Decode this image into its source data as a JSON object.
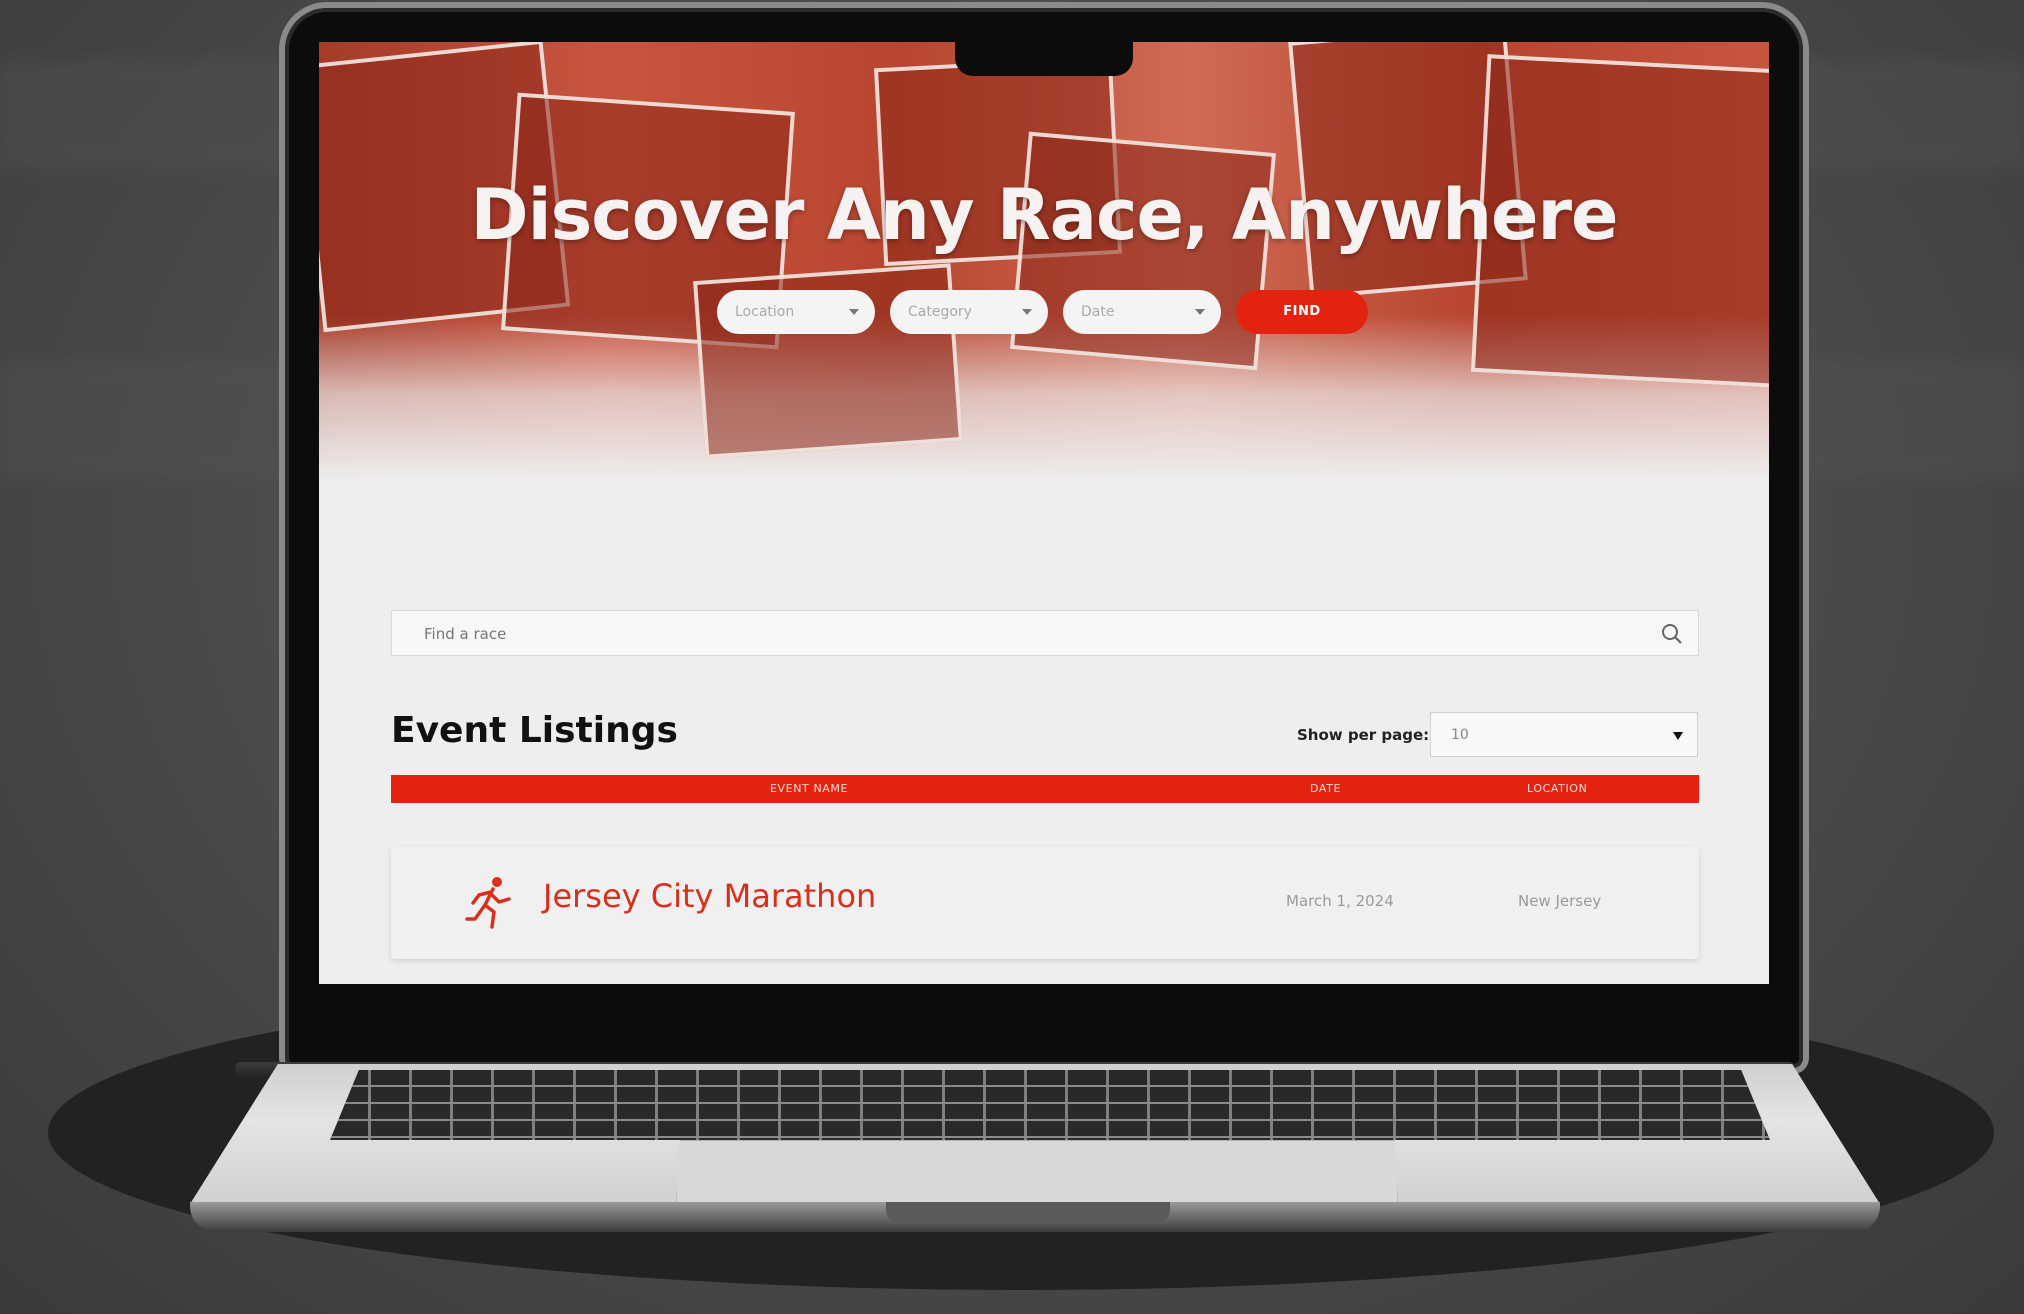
{
  "hero": {
    "title": "Discover Any Race, Anywhere",
    "filters": [
      {
        "placeholder": "Location"
      },
      {
        "placeholder": "Category"
      },
      {
        "placeholder": "Date"
      }
    ],
    "find_label": "FIND"
  },
  "search": {
    "placeholder": "Find a race"
  },
  "listings": {
    "title": "Event Listings",
    "per_page_label": "Show per page:",
    "per_page_value": "10",
    "columns": [
      "EVENT NAME",
      "DATE",
      "LOCATION"
    ],
    "rows": [
      {
        "name": "Jersey City Marathon",
        "date": "March 1, 2024",
        "location": "New Jersey"
      }
    ]
  },
  "colors": {
    "accent": "#e3230f",
    "hero_tint": "#c24a35",
    "event_name": "#d7301c"
  },
  "icons": {
    "search": "search-icon",
    "dropdown": "chevron-down-icon",
    "event": "runner-icon"
  }
}
